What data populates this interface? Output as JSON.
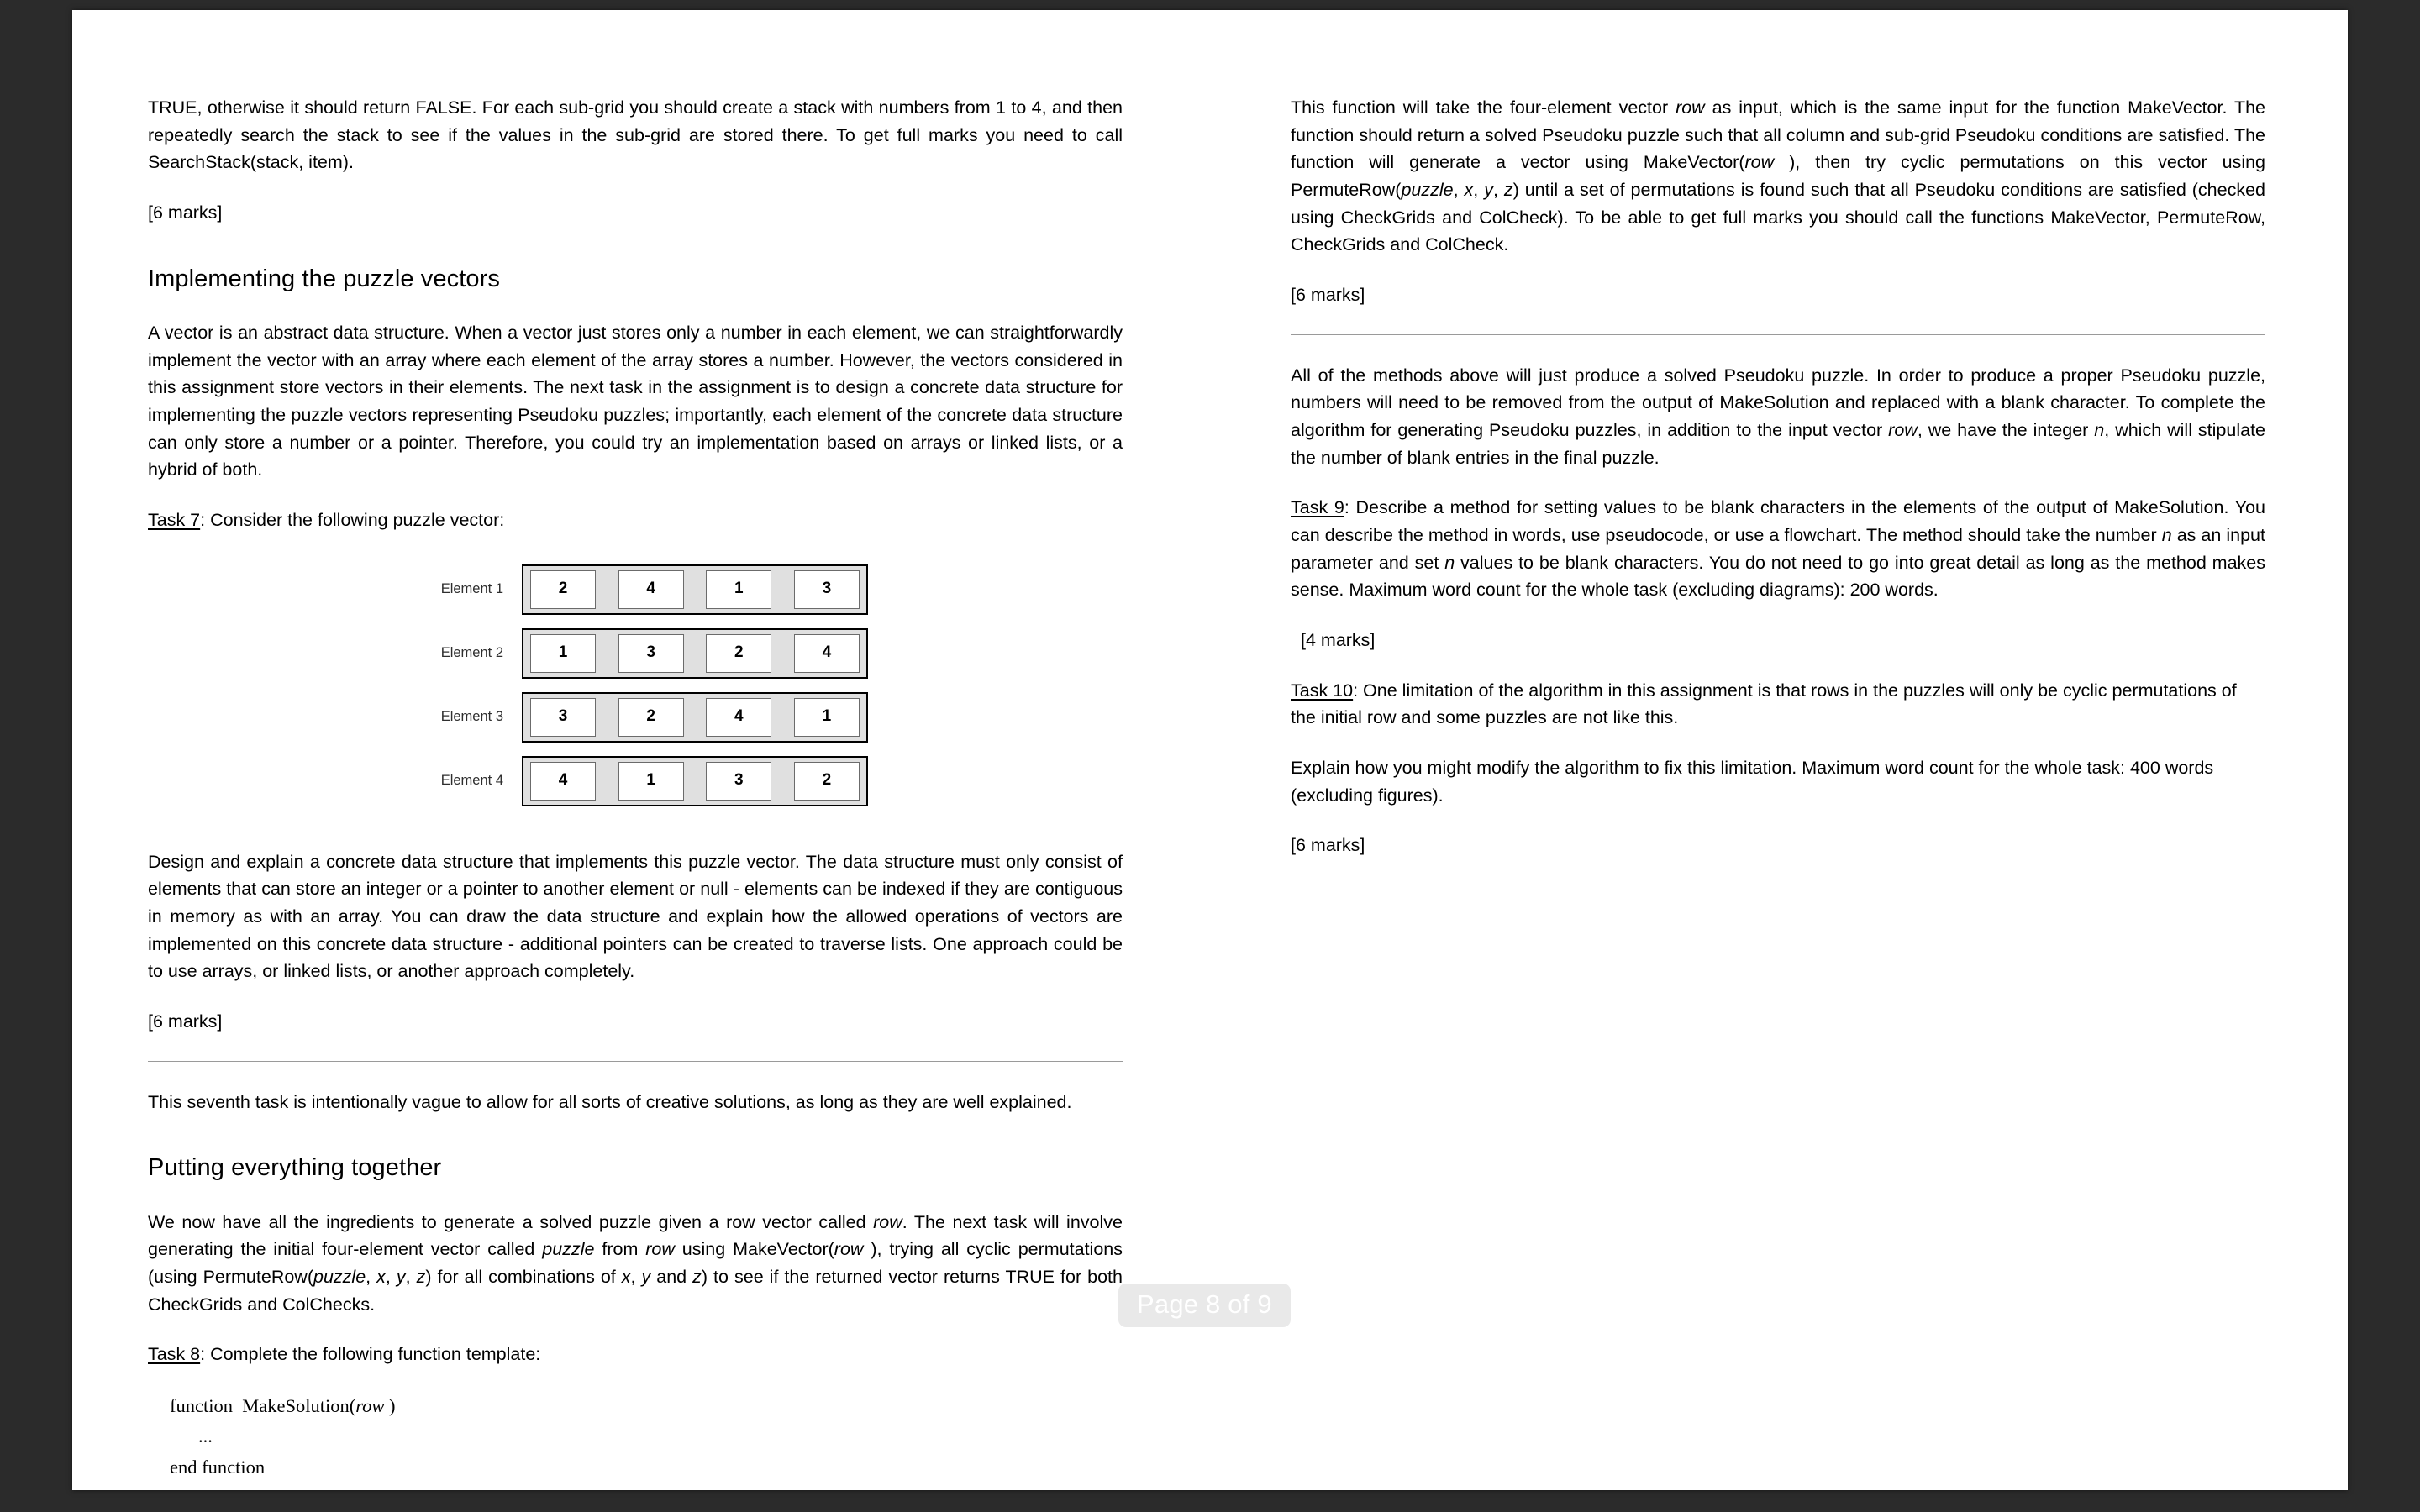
{
  "viewer": {
    "page_indicator": "Page 8 of 9"
  },
  "left_column": {
    "continued_paragraph": "TRUE, otherwise it should return FALSE. For each sub-grid you should create a stack with numbers from 1 to 4, and then repeatedly search the stack to see if the values in the sub-grid are stored there. To get full marks you need to call  SearchStack(stack,  item).",
    "marks_1": "[6 marks]",
    "heading_1": "Implementing the puzzle vectors",
    "vector_paragraph": "A vector is an abstract data structure. When a vector just stores only a number in each element, we can straightforwardly implement the vector with an array where each element of the array stores a number. However, the vectors considered in this assignment store vectors in their elements. The next task in the assignment is to design a concrete data structure for implementing the puzzle vectors representing Pseudoku puzzles; importantly, each element of the concrete data structure can only store a number or a pointer. Therefore, you could try an implementation based on arrays or linked lists, or a hybrid of both.",
    "task7_label": "Task 7",
    "task7_text": ": Consider the following puzzle vector:",
    "figure": {
      "row_labels": [
        "Element 1",
        "Element 2",
        "Element 3",
        "Element 4"
      ],
      "rows": [
        [
          "2",
          "4",
          "1",
          "3"
        ],
        [
          "1",
          "3",
          "2",
          "4"
        ],
        [
          "3",
          "2",
          "4",
          "1"
        ],
        [
          "4",
          "1",
          "3",
          "2"
        ]
      ]
    },
    "design_paragraph": "Design and explain a concrete data structure that implements this puzzle vector. The data structure must only consist of elements that can store an integer or a pointer to another element or null - elements can be indexed if they are contiguous in memory as with an array. You can draw the data structure and explain how the allowed operations of vectors are implemented on this concrete data structure - additional pointers can be created to traverse lists. One approach could be to use arrays, or linked lists, or another approach completely.",
    "marks_2": "[6 marks]",
    "footnote": "This seventh task is intentionally vague to allow for all sorts of creative solutions, as long as they are well explained.",
    "heading_2": "Putting everything together",
    "together_p1_a": "We now have all the ingredients to generate a solved puzzle given a row vector called ",
    "together_p1_row": "row",
    "together_p1_b": ". The next task will involve generating the initial four-element vector called ",
    "together_p1_puzzle": "puzzle",
    "together_p1_c": " from ",
    "together_p1_row2": "row",
    "together_p1_d": " using MakeVector(",
    "together_p1_row3": "row",
    "together_p1_e": " ), trying all cyclic permutations (using PermuteRow(",
    "together_p1_puzzle2": "puzzle",
    "together_p1_f": ", ",
    "together_p1_x": "x",
    "together_p1_y": "y",
    "together_p1_z": "z",
    "together_p1_g": ") for all combinations of ",
    "together_p1_h": " and ",
    "together_p1_i": ") to see if the returned vector returns  TRUE  for  both  CheckGrids  and  ColChecks.",
    "task8_label": "Task 8",
    "task8_text": ": Complete the following function template:",
    "code": {
      "line1_a": "function  MakeSolution(",
      "line1_row": "row",
      "line1_b": " )",
      "line2": "...",
      "line3": "end function"
    }
  },
  "right_column": {
    "p1_a": "This function will take the four-element vector ",
    "p1_row": "row",
    "p1_b": " as input, which is the same input for the function MakeVector. The function should return a solved Pseudoku puzzle such that all column and sub-grid Pseudoku conditions are satisfied.  The function will generate a vector using MakeVector(",
    "p1_row2": "row",
    "p1_c": " ), then try cyclic permutations on this vector using PermuteRow(",
    "p1_puzzle": "puzzle",
    "p1_x": "x",
    "p1_y": "y",
    "p1_z": "z",
    "p1_d": ") until a set of permutations is found such that all Pseudoku conditions are satisfied (checked using CheckGrids and ColCheck).  To be able to get full marks you should call the functions  MakeVector,  PermuteRow,  CheckGrids  and  ColCheck.",
    "marks_1": "[6 marks]",
    "methods_a": "All of the methods above will just produce a solved Pseudoku puzzle. In order to produce a proper Pseudoku puzzle, numbers will need to be removed from the output of MakeSolution and replaced with a blank character. To complete the algorithm for generating Pseudoku puzzles, in addition to the input vector ",
    "methods_row": "row",
    "methods_b": ", we have the integer ",
    "methods_n": "n",
    "methods_c": ", which will stipulate the number of blank entries in the final puzzle.",
    "task9_label": "Task 9",
    "task9_a": ": Describe a method for setting values to be blank characters in the elements of the output of MakeSolution.  You can describe the method in words, use pseudocode, or use a flowchart.  The method should take the number ",
    "task9_n1": "n",
    "task9_b": " as an input parameter and set ",
    "task9_n2": "n",
    "task9_c": " values to be blank characters.  You do not need to go into great detail as long as the method makes sense.  Maximum word count for the whole task (excluding diagrams): 200 words.",
    "marks_2": "[4 marks]",
    "task10_label": "Task 10",
    "task10_text": ": One limitation of the algorithm in this assignment is that rows in the puzzles will only be cyclic permutations of the initial row and some puzzles are not like this.",
    "explain_text": "Explain how you might modify the algorithm to fix this limitation. Maximum word count for the whole task: 400 words (excluding figures).",
    "marks_3": "[6 marks]"
  }
}
